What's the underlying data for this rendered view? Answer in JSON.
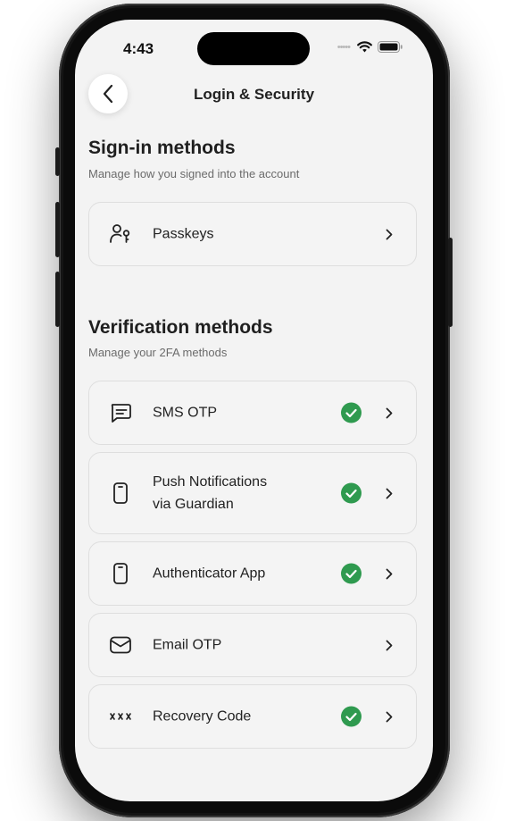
{
  "status_bar": {
    "time": "4:43"
  },
  "nav": {
    "title": "Login & Security"
  },
  "sign_in": {
    "title": "Sign-in methods",
    "subtitle": "Manage how you signed into the account",
    "items": [
      {
        "label": "Passkeys",
        "icon": "passkey-icon",
        "enabled": false
      }
    ]
  },
  "verification": {
    "title": "Verification methods",
    "subtitle": "Manage your 2FA methods",
    "items": [
      {
        "label": "SMS OTP",
        "icon": "message-icon",
        "enabled": true
      },
      {
        "label_line1": "Push Notifications",
        "label_line2": "via Guardian",
        "icon": "phone-icon",
        "enabled": true
      },
      {
        "label": "Authenticator App",
        "icon": "phone-icon",
        "enabled": true
      },
      {
        "label": "Email OTP",
        "icon": "mail-icon",
        "enabled": false
      },
      {
        "label": "Recovery Code",
        "icon": "asterisks-icon",
        "enabled": true
      }
    ]
  },
  "colors": {
    "check": "#2f9a4f",
    "background": "#f3f3f3",
    "card_border": "#dedede"
  }
}
